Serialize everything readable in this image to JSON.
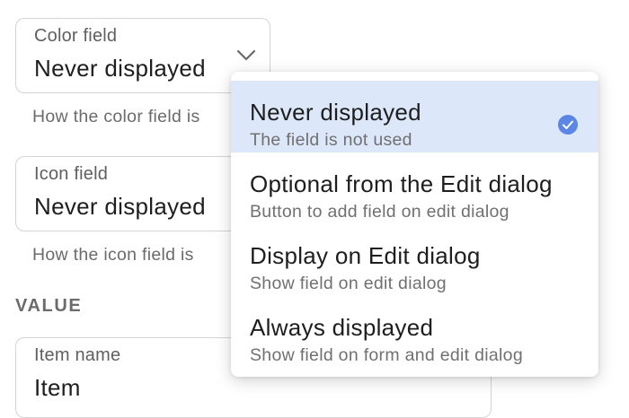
{
  "color_field": {
    "label": "Color field",
    "value": "Never displayed",
    "help": "How the color field is"
  },
  "icon_field": {
    "label": "Icon field",
    "value": "Never displayed",
    "help": "How the icon field is"
  },
  "section": {
    "value_heading": "VALUE"
  },
  "item_name": {
    "label": "Item name",
    "value": "Item"
  },
  "dropdown": {
    "selected_index": 0,
    "options": [
      {
        "title": "Never displayed",
        "subtitle": "The field is not used"
      },
      {
        "title": "Optional from the Edit dialog",
        "subtitle": "Button to add field on edit dialog"
      },
      {
        "title": "Display on Edit dialog",
        "subtitle": "Show field on edit dialog"
      },
      {
        "title": "Always displayed",
        "subtitle": "Show field on form and edit dialog"
      }
    ]
  },
  "colors": {
    "accent": "#5b86e5",
    "selected_bg": "#dde7fa"
  },
  "icons": {
    "chevron": "chevron-down-icon",
    "check": "check-circle-icon"
  }
}
